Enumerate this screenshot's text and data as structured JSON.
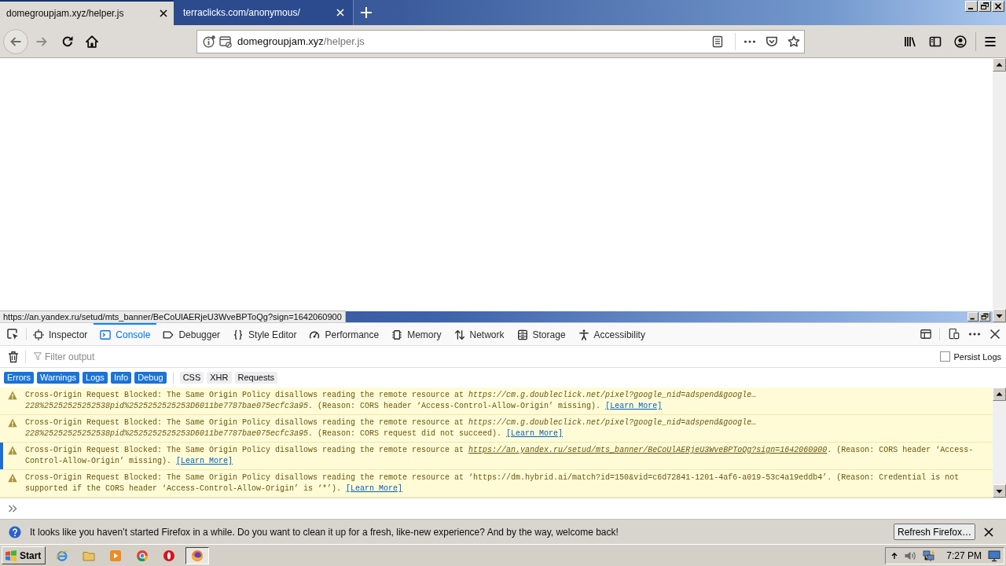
{
  "tabs": [
    {
      "title": "domegroupjam.xyz/helper.js",
      "selected": true
    },
    {
      "title": "terraclicks.com/anonymous/",
      "selected": false
    }
  ],
  "address_bar": {
    "host": "domegroupjam.xyz",
    "path": "/helper.js"
  },
  "status_url": "https://an.yandex.ru/setud/mts_banner/BeCoUlAERjeU3WveBPToQg?sign=1642060900",
  "devtools": {
    "tools": [
      {
        "label": "Inspector",
        "selected": false
      },
      {
        "label": "Console",
        "selected": true
      },
      {
        "label": "Debugger",
        "selected": false
      },
      {
        "label": "Style Editor",
        "selected": false
      },
      {
        "label": "Performance",
        "selected": false
      },
      {
        "label": "Memory",
        "selected": false
      },
      {
        "label": "Network",
        "selected": false
      },
      {
        "label": "Storage",
        "selected": false
      },
      {
        "label": "Accessibility",
        "selected": false
      }
    ],
    "filter": {
      "placeholder": "Filter output"
    },
    "persist_logs": {
      "label": "Persist Logs",
      "checked": false
    },
    "filters": {
      "levels": [
        {
          "label": "Errors",
          "selected": true
        },
        {
          "label": "Warnings",
          "selected": true
        },
        {
          "label": "Logs",
          "selected": true
        },
        {
          "label": "Info",
          "selected": true
        },
        {
          "label": "Debug",
          "selected": true
        }
      ],
      "types": [
        {
          "label": "CSS",
          "selected": false
        },
        {
          "label": "XHR",
          "selected": false
        },
        {
          "label": "Requests",
          "selected": false
        }
      ]
    },
    "messages": [
      {
        "kind": "warning",
        "selected": false,
        "parts": [
          {
            "kind": "text",
            "text": "Cross-Origin Request Blocked: The Same Origin Policy disallows reading the remote resource at "
          },
          {
            "kind": "url",
            "text": "https://cm.g.doubleclick.net/pixel?google_nid=adspend&google…228%25252525252538pid%2525252525253D6011be7787bae075ecfc3a95"
          },
          {
            "kind": "text",
            "text": ". (Reason: CORS header ‘Access-Control-Allow-Origin’ missing). "
          },
          {
            "kind": "link",
            "text": "[Learn More]"
          }
        ]
      },
      {
        "kind": "warning",
        "selected": false,
        "parts": [
          {
            "kind": "text",
            "text": "Cross-Origin Request Blocked: The Same Origin Policy disallows reading the remote resource at "
          },
          {
            "kind": "url",
            "text": "https://cm.g.doubleclick.net/pixel?google_nid=adspend&google…228%25252525252538pid%2525252525253D6011be7787bae075ecfc3a95"
          },
          {
            "kind": "text",
            "text": ". (Reason: CORS request did not succeed). "
          },
          {
            "kind": "link",
            "text": "[Learn More]"
          }
        ]
      },
      {
        "kind": "warning",
        "selected": true,
        "parts": [
          {
            "kind": "text",
            "text": "Cross-Origin Request Blocked: The Same Origin Policy disallows reading the remote resource at "
          },
          {
            "kind": "url",
            "text": "https://an.yandex.ru/setud/mts_banner/BeCoUlAERjeU3WveBPToQg?sign=1642060900"
          },
          {
            "kind": "text",
            "text": ". (Reason: CORS header ‘Access-Control-Allow-Origin’ missing). "
          },
          {
            "kind": "link",
            "text": "[Learn More]"
          }
        ]
      },
      {
        "kind": "warning",
        "selected": false,
        "parts": [
          {
            "kind": "text",
            "text": "Cross-Origin Request Blocked: The Same Origin Policy disallows reading the remote resource at ‘https://dm.hybrid.ai/match?id=150&vid=c6d72841-1201-4af6-a019-53c4a19eddb4’. (Reason: Credential is not supported if the CORS header ‘Access-Control-Allow-Origin’ is ‘*’). "
          },
          {
            "kind": "link",
            "text": "[Learn More]"
          }
        ]
      }
    ]
  },
  "notification": {
    "text": "It looks like you haven’t started Firefox in a while. Do you want to clean it up for a fresh, like-new experience? And by the way, welcome back!",
    "button": "Refresh Firefox…"
  },
  "taskbar": {
    "start": "Start",
    "apps": [
      {
        "selected": false
      },
      {
        "selected": false
      },
      {
        "selected": false
      },
      {
        "selected": false
      },
      {
        "selected": false
      },
      {
        "selected": true
      }
    ],
    "clock": "7:27 PM"
  }
}
